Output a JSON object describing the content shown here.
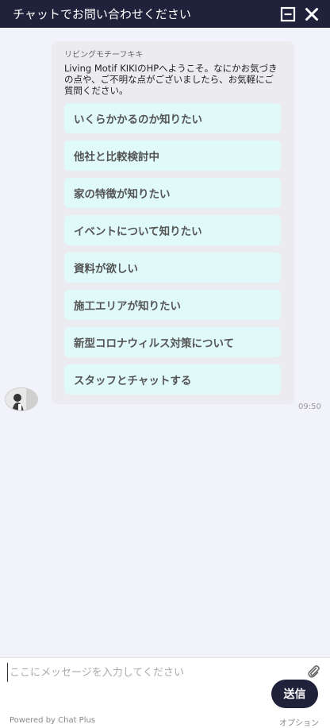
{
  "header": {
    "title": "チャットでお問い合わせください",
    "minimize_icon": "minimize-icon",
    "close_icon": "close-icon"
  },
  "message": {
    "sender": "リビングモチーフキキ",
    "text": "Living Motif KIKIのHPへようこそ。なにかお気づきの点や、ご不明な点がございましたら、お気軽にご質問ください。",
    "time": "09:50",
    "choices": [
      "いくらかかるのか知りたい",
      "他社と比較検討中",
      "家の特徴が知りたい",
      "イベントについて知りたい",
      "資料が欲しい",
      "施工エリアが知りたい",
      "新型コロナウィルス対策について",
      "スタッフとチャットする"
    ]
  },
  "composer": {
    "placeholder": "ここにメッセージを入力してください",
    "value": "",
    "send_label": "送信",
    "attach_icon": "paperclip-icon"
  },
  "footer": {
    "powered_by": "Powered by Chat Plus",
    "option_label": "オプション"
  },
  "colors": {
    "header_bg": "#20213a",
    "chat_bg": "#f2f2fb",
    "choice_bg": "#e0fafa",
    "send_bg": "#20213a"
  }
}
